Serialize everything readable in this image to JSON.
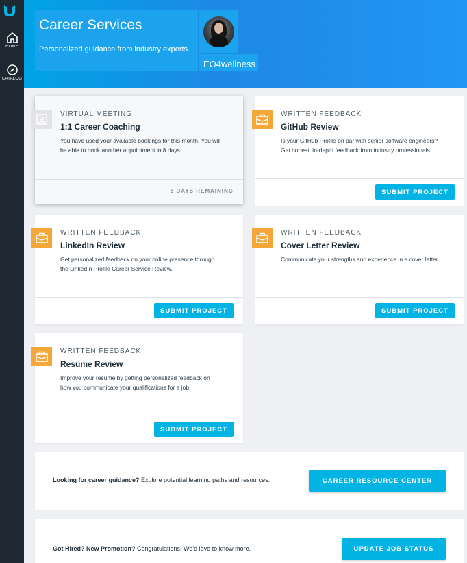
{
  "sidebar": {
    "items": [
      {
        "label": "HOME",
        "icon": "home-icon"
      },
      {
        "label": "CATALOG",
        "icon": "compass-icon"
      }
    ]
  },
  "header": {
    "title": "Career Services",
    "subtitle": "Personalized guidance from industry experts.",
    "username": "EO4wellness"
  },
  "cards": [
    {
      "eyebrow": "VIRTUAL MEETING",
      "title": "1:1 Career Coaching",
      "description": "You have used your available bookings for this month. You will be able to book another appointment in 8 days.",
      "status": "8 DAYS REMAINING"
    },
    {
      "eyebrow": "WRITTEN FEEDBACK",
      "title": "GitHub Review",
      "description": "Is your GitHub Profile on par with senior software engineers? Get honest, in-depth feedback from industry professionals.",
      "button": "SUBMIT PROJECT"
    },
    {
      "eyebrow": "WRITTEN FEEDBACK",
      "title": "LinkedIn Review",
      "description": "Get personalized feedback on your online presence through the LinkedIn Profile Career Service Review.",
      "button": "SUBMIT PROJECT"
    },
    {
      "eyebrow": "WRITTEN FEEDBACK",
      "title": "Cover Letter Review",
      "description": "Communicate your strengths and experience in a cover letter.",
      "button": "SUBMIT PROJECT"
    },
    {
      "eyebrow": "WRITTEN FEEDBACK",
      "title": "Resume Review",
      "description": "Improve your resume by getting personalized feedback on how you communicate your qualifications for a job.",
      "button": "SUBMIT PROJECT"
    }
  ],
  "banners": {
    "guidance": {
      "bold": "Looking for career guidance?",
      "text": " Explore potential learning paths and resources.",
      "button": "CAREER RESOURCE CENTER"
    },
    "hired": {
      "bold": "Got Hired? New Promotion?",
      "text": " Congratulations! We'd love to know more.",
      "button": "UPDATE JOB STATUS"
    }
  },
  "colors": {
    "accent": "#02b3e4",
    "badge": "#f6a73a",
    "sidebar": "#1d2833"
  }
}
